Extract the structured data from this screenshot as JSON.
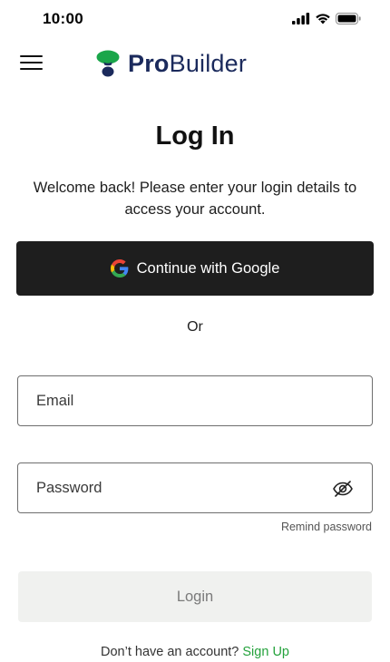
{
  "status_bar": {
    "time": "10:00",
    "icons": [
      "cellular-signal-icon",
      "wifi-icon",
      "battery-icon"
    ]
  },
  "header": {
    "menu_icon": "hamburger-menu-icon",
    "logo": {
      "icon": "probuilder-logo-icon",
      "text_bold": "Pro",
      "text_regular": "Builder",
      "colors": {
        "text": "#1b2a5c",
        "green": "#1aa64a",
        "navy": "#1b2a5c"
      }
    }
  },
  "main": {
    "title": "Log In",
    "subtitle": "Welcome back! Please enter your login details to access your account.",
    "google_button": {
      "label": "Continue with Google",
      "icon": "google-icon"
    },
    "divider_text": "Or",
    "email_field": {
      "placeholder": "Email",
      "value": ""
    },
    "password_field": {
      "placeholder": "Password",
      "value": "",
      "toggle_icon": "eye-off-icon"
    },
    "remind_password": "Remind password",
    "login_button": {
      "label": "Login",
      "state": "disabled"
    },
    "signup_prompt": "Don’t have an account?",
    "signup_link": "Sign Up"
  },
  "colors": {
    "primary_button_bg": "#1e1e1e",
    "disabled_button_bg": "#f0f1ef",
    "link_green": "#24a23c",
    "border": "#6e6e6e"
  }
}
